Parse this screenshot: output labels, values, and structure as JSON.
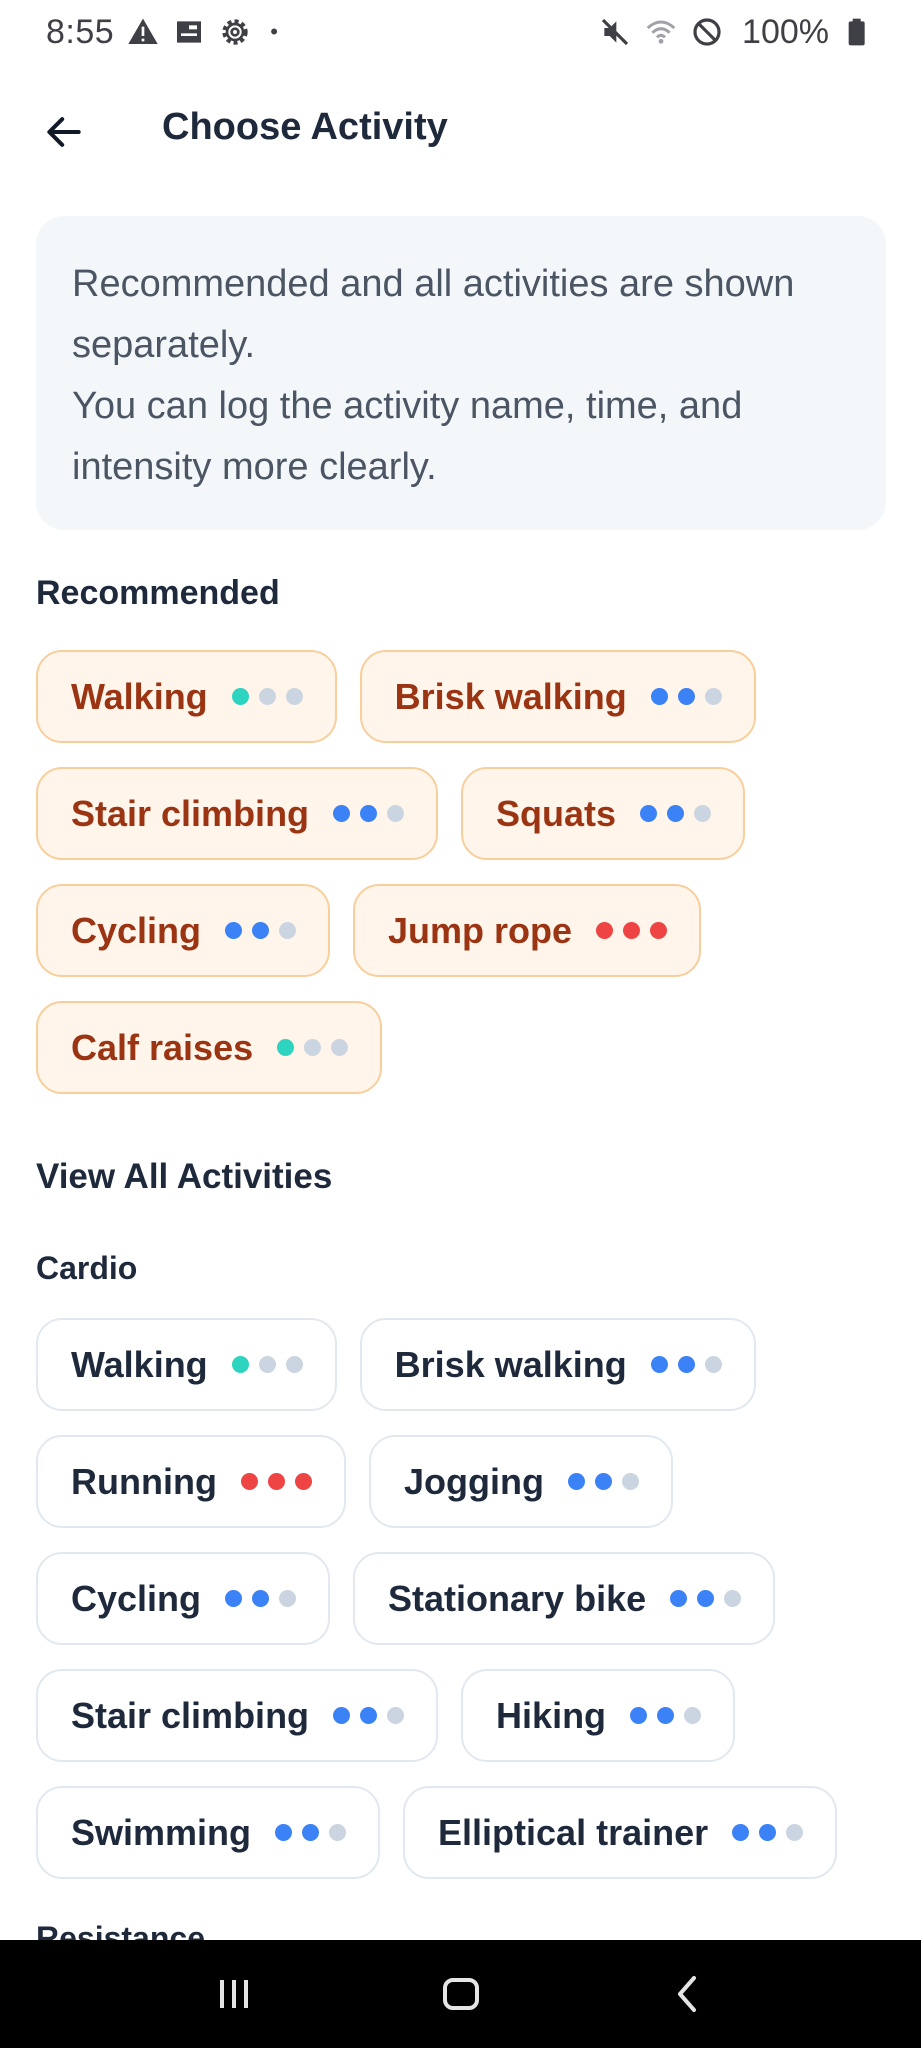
{
  "status_bar": {
    "time": "8:55",
    "battery": "100%",
    "dot": "•",
    "left_icons": [
      "alert-icon",
      "sim-card-icon",
      "settings-gear-icon"
    ],
    "right_icons": [
      "mute-icon",
      "wifi-icon",
      "do-not-disturb-icon",
      "battery-icon"
    ]
  },
  "app_bar": {
    "title": "Choose Activity",
    "back_icon": "arrow-left-icon"
  },
  "info": {
    "line1": "Recommended and all activities are shown separately.",
    "line2": "You can log the activity name, time, and intensity more clearly."
  },
  "recommended": {
    "heading": "Recommended",
    "items": [
      {
        "label": "Walking",
        "dots": [
          "#2dd4bf",
          "#cbd5e1",
          "#cbd5e1"
        ]
      },
      {
        "label": "Brisk walking",
        "dots": [
          "#3b82f6",
          "#3b82f6",
          "#cbd5e1"
        ]
      },
      {
        "label": "Stair climbing",
        "dots": [
          "#3b82f6",
          "#3b82f6",
          "#cbd5e1"
        ]
      },
      {
        "label": "Squats",
        "dots": [
          "#3b82f6",
          "#3b82f6",
          "#cbd5e1"
        ]
      },
      {
        "label": "Cycling",
        "dots": [
          "#3b82f6",
          "#3b82f6",
          "#cbd5e1"
        ]
      },
      {
        "label": "Jump rope",
        "dots": [
          "#ef4444",
          "#ef4444",
          "#ef4444"
        ]
      },
      {
        "label": "Calf raises",
        "dots": [
          "#2dd4bf",
          "#cbd5e1",
          "#cbd5e1"
        ]
      }
    ]
  },
  "all_activities": {
    "heading": "View All Activities",
    "cardio": {
      "heading": "Cardio",
      "items": [
        {
          "label": "Walking",
          "dots": [
            "#2dd4bf",
            "#cbd5e1",
            "#cbd5e1"
          ]
        },
        {
          "label": "Brisk walking",
          "dots": [
            "#3b82f6",
            "#3b82f6",
            "#cbd5e1"
          ]
        },
        {
          "label": "Running",
          "dots": [
            "#ef4444",
            "#ef4444",
            "#ef4444"
          ]
        },
        {
          "label": "Jogging",
          "dots": [
            "#3b82f6",
            "#3b82f6",
            "#cbd5e1"
          ]
        },
        {
          "label": "Cycling",
          "dots": [
            "#3b82f6",
            "#3b82f6",
            "#cbd5e1"
          ]
        },
        {
          "label": "Stationary bike",
          "dots": [
            "#3b82f6",
            "#3b82f6",
            "#cbd5e1"
          ]
        },
        {
          "label": "Stair climbing",
          "dots": [
            "#3b82f6",
            "#3b82f6",
            "#cbd5e1"
          ]
        },
        {
          "label": "Hiking",
          "dots": [
            "#3b82f6",
            "#3b82f6",
            "#cbd5e1"
          ]
        },
        {
          "label": "Swimming",
          "dots": [
            "#3b82f6",
            "#3b82f6",
            "#cbd5e1"
          ]
        },
        {
          "label": "Elliptical trainer",
          "dots": [
            "#3b82f6",
            "#3b82f6",
            "#cbd5e1"
          ]
        }
      ]
    },
    "resistance": {
      "heading": "Resistance"
    }
  },
  "nav_bar": {
    "icons": [
      "recent-apps-icon",
      "home-icon",
      "back-icon"
    ]
  },
  "colors": {
    "recommended_chip_bg": "#fff5ea",
    "recommended_chip_border": "#f8cf9c",
    "recommended_chip_text": "#9a3412",
    "info_bg": "#f3f7fa",
    "title_text": "#1e293b"
  }
}
